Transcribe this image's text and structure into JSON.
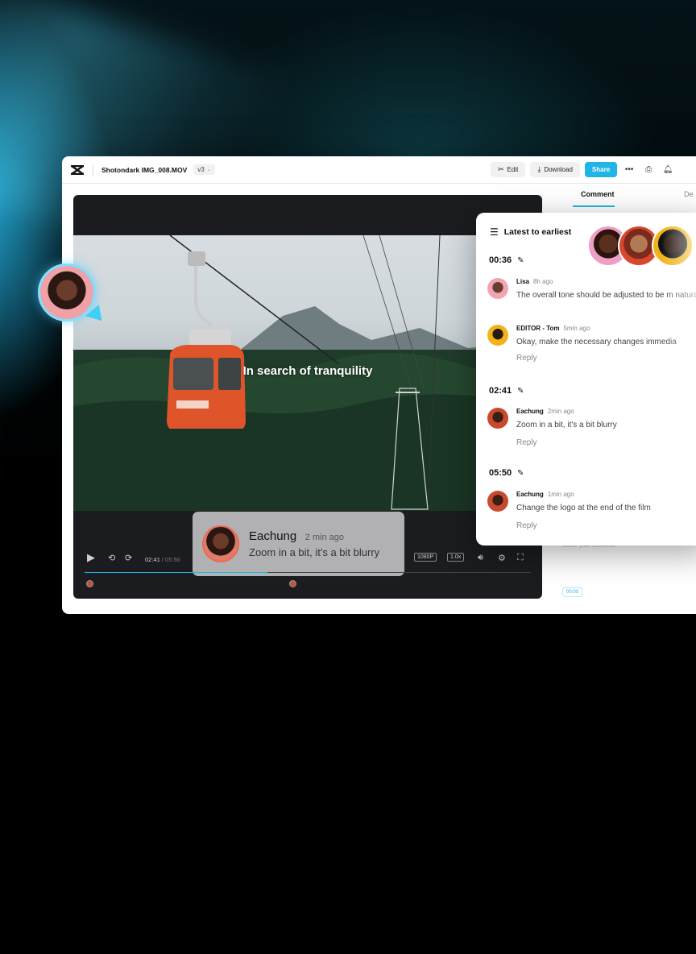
{
  "window": {
    "filename": "Shotondark IMG_008.MOV",
    "version": "v3"
  },
  "toolbar": {
    "edit_label": "Edit",
    "download_label": "Download",
    "share_label": "Share"
  },
  "player": {
    "caption": "In search of tranquility",
    "current_time": "02:41",
    "total_time": "/ 05:56",
    "quality": "1080P",
    "speed": "1.0x",
    "progress_fraction": 0.41
  },
  "floating_comment": {
    "name": "Eachung",
    "time": "2 min ago",
    "text": "Zoom in a bit, it's a bit blurry"
  },
  "side_panel": {
    "tab_comment": "Comment",
    "tab_detail": "De",
    "leave_comment_placeholder": "Leave your comment",
    "time_chip": "00:00"
  },
  "popup": {
    "sort_label": "Latest to earliest",
    "sections": [
      {
        "time": "00:36",
        "comments": [
          {
            "name": "Lisa",
            "time": "8h ago",
            "text": "The overall tone should be adjusted to be m natural."
          },
          {
            "name": "EDITOR - Tom",
            "time": "5min ago",
            "text": "Okay, make the necessary changes immedia"
          }
        ],
        "reply": "Reply"
      },
      {
        "time": "02:41",
        "comments": [
          {
            "name": "Eachung",
            "time": "2min ago",
            "text": "Zoom in a bit, it's a bit blurry"
          }
        ],
        "reply": "Reply"
      },
      {
        "time": "05:50",
        "comments": [
          {
            "name": "Eachung",
            "time": "1min ago",
            "text": "Change the logo at the end of the film"
          }
        ],
        "reply": "Reply"
      }
    ]
  }
}
